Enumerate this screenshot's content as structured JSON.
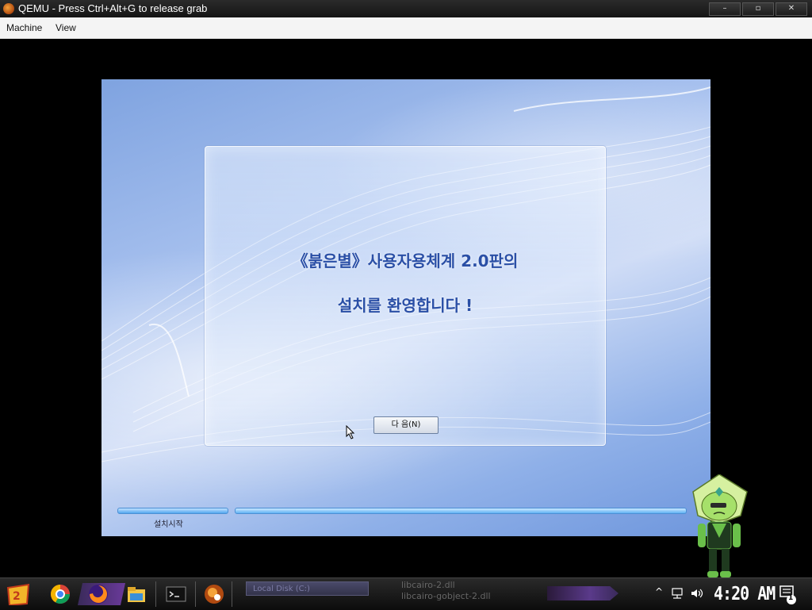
{
  "window": {
    "title": "QEMU - Press Ctrl+Alt+G to release grab",
    "buttons": [
      "–",
      "▫",
      "✕"
    ]
  },
  "menubar": {
    "items": [
      "Machine",
      "View"
    ]
  },
  "installer": {
    "welcome_line1": "《붉은별》사용자용체계 2.0판의",
    "welcome_line2": "설치를 환영합니다 !",
    "next_button": "다 음(N)",
    "step_label": "설치시작"
  },
  "taskbar": {
    "window_title": "Local Disk (C:)",
    "file_label_1": "libcairo-2.dll",
    "file_label_2": "libcairo-gobject-2.dll",
    "clock": "4:20 AM",
    "notification_count": "1",
    "icons": [
      "start-icon",
      "chrome-icon",
      "firefox-icon",
      "file-explorer-icon",
      "terminal-icon",
      "qemu-icon"
    ]
  },
  "colors": {
    "title_text": "#2a4fa6",
    "progress_bar": "#52a7ef",
    "taskbar_bg": "#0c0c0c"
  }
}
